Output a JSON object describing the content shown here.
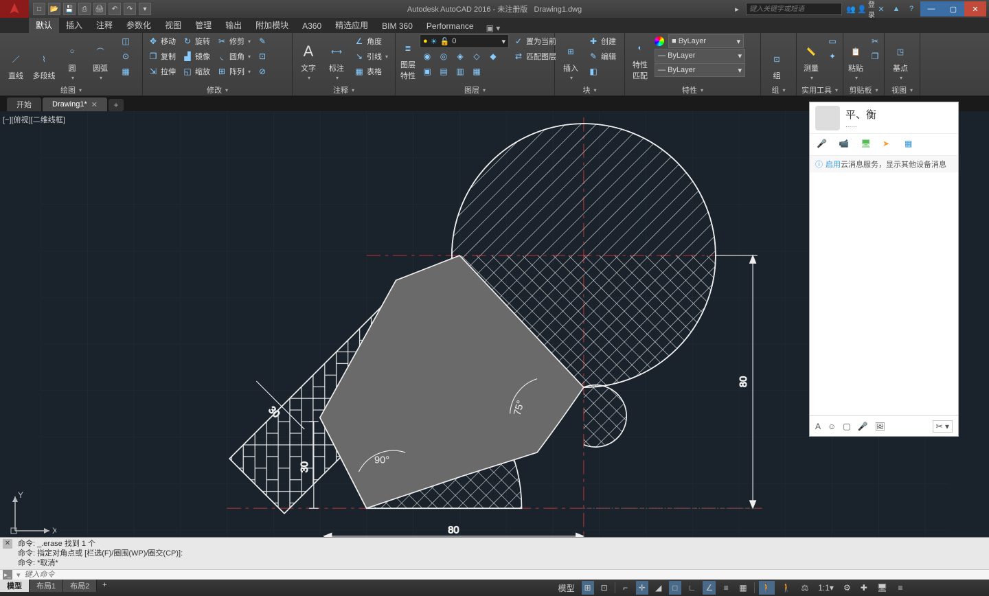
{
  "app": {
    "title": "Autodesk AutoCAD 2016 - 未注册版",
    "document": "Drawing1.dwg",
    "search_placeholder": "键入关键字或短语",
    "login": "登录"
  },
  "qat": [
    "new",
    "open",
    "save",
    "saveas",
    "plot",
    "undo",
    "redo"
  ],
  "ribbon_tabs": [
    "默认",
    "插入",
    "注释",
    "参数化",
    "视图",
    "管理",
    "输出",
    "附加模块",
    "A360",
    "精选应用",
    "BIM 360",
    "Performance"
  ],
  "ribbon_active": 0,
  "panels": {
    "draw": {
      "title": "绘图",
      "big": [
        "直线",
        "多段线",
        "圆",
        "圆弧"
      ]
    },
    "modify": {
      "title": "修改",
      "items": [
        [
          "移动",
          "旋转",
          "修剪"
        ],
        [
          "复制",
          "镜像",
          "圆角"
        ],
        [
          "拉伸",
          "缩放",
          "阵列"
        ]
      ]
    },
    "annotate": {
      "title": "注释",
      "big": [
        "文字",
        "标注"
      ],
      "items": [
        "角度",
        "引线",
        "表格"
      ]
    },
    "layer": {
      "title": "图层",
      "big": "图层\n特性",
      "current": "0",
      "btns": [
        "置为当前",
        "匹配图层"
      ]
    },
    "block": {
      "title": "块",
      "big": "插入",
      "items": [
        "创建",
        "编辑"
      ]
    },
    "props": {
      "title": "特性",
      "big": "特性\n匹配",
      "combos": [
        "ByLayer",
        "ByLayer",
        "ByLayer"
      ]
    },
    "group": {
      "title": "组",
      "big": "组"
    },
    "utils": {
      "title": "实用工具",
      "big": "测量"
    },
    "clip": {
      "title": "剪贴板",
      "big": "粘贴"
    },
    "view": {
      "title": "视图",
      "big": "基点"
    }
  },
  "file_tabs": {
    "start": "开始",
    "doc": "Drawing1*",
    "active": 1
  },
  "viewport_label": "[−][俯视][二维线框]",
  "dimensions": {
    "d1": "30",
    "d2": "30",
    "d3": "80",
    "d4": "80",
    "a1": "90°",
    "a2": "75°"
  },
  "ucs": {
    "x": "X",
    "y": "Y"
  },
  "qq": {
    "name": "平、衡",
    "sub": "......",
    "info_prefix": "启用",
    "info_rest": "云消息服务，显示其他设备消息"
  },
  "cmd": {
    "l1": "命令: _.erase 找到 1 个",
    "l2": "命令: 指定对角点或 [栏选(F)/圈围(WP)/圈交(CP)]:",
    "l3": "命令: *取消*",
    "placeholder": "键入命令"
  },
  "layout_tabs": {
    "model": "模型",
    "l1": "布局1",
    "l2": "布局2"
  },
  "status": {
    "model": "模型",
    "scale": "1:1"
  }
}
